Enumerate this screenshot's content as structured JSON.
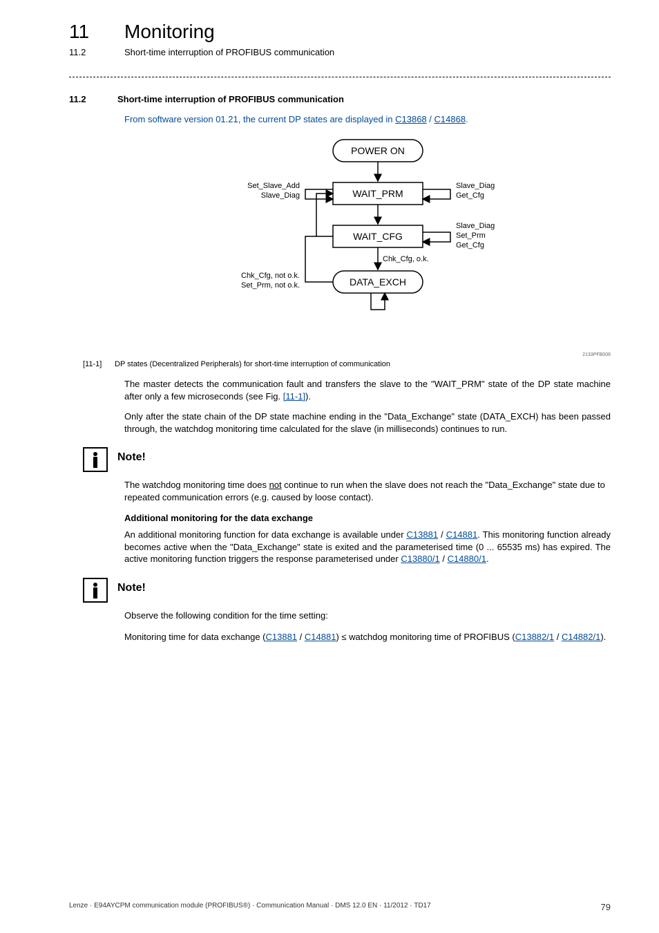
{
  "header": {
    "chapter_number": "11",
    "chapter_title": "Monitoring",
    "sub_number": "11.2",
    "sub_title": "Short-time interruption of PROFIBUS communication"
  },
  "section": {
    "number": "11.2",
    "title": "Short-time interruption of PROFIBUS communication"
  },
  "intro": {
    "prefix": "From software version 01.21, the current DP states are displayed in ",
    "link1": "C13868",
    "sep": " / ",
    "link2": "C14868",
    "suffix": "."
  },
  "diagram": {
    "power_on": "POWER ON",
    "wait_prm": "WAIT_PRM",
    "wait_cfg": "WAIT_CFG",
    "data_exch": "DATA_EXCH",
    "left_top1": "Set_Slave_Add",
    "left_top2": "Slave_Diag",
    "right_top1": "Slave_Diag",
    "right_top2": "Get_Cfg",
    "right_mid1": "Slave_Diag",
    "right_mid2": "Set_Prm",
    "right_mid3": "Get_Cfg",
    "chk_ok": "Chk_Cfg, o.k.",
    "left_bot1": "Chk_Cfg, not o.k.",
    "left_bot2": "Set_Prm, not o.k.",
    "code": "2133PFB006"
  },
  "figure": {
    "label": "[11-1]",
    "caption": "DP states (Decentralized Peripherals) for short-time interruption of communication"
  },
  "para1": {
    "t1": "The master detects the communication fault and transfers the slave to the \"WAIT_PRM\" state of the DP state machine after only a few microseconds (see Fig. ",
    "link": "[11-1]",
    "t2": ")."
  },
  "para2": "Only after the state chain of the DP state machine ending in the \"Data_Exchange\" state (DATA_EXCH) has been passed through, the watchdog monitoring time calculated for the slave (in milliseconds) continues to run.",
  "note1": {
    "title": "Note!",
    "body_a": "The watchdog monitoring time does ",
    "body_u": "not",
    "body_b": " continue to run when the slave does not reach the \"Data_Exchange\" state due to repeated communication errors (e.g. caused by loose contact)."
  },
  "subhead": "Additional monitoring for the data exchange",
  "para3": {
    "t1": "An additional monitoring function for data exchange is available under ",
    "l1": "C13881",
    "sep1": " / ",
    "l2": "C14881",
    "t2": ". This monitoring function already becomes active when the \"Data_Exchange\" state is exited and the parameterised time (0 ... 65535 ms) has expired. The active monitoring function triggers the response parameterised under ",
    "l3": "C13880/1",
    "sep2": " / ",
    "l4": "C14880/1",
    "t3": "."
  },
  "note2": {
    "title": "Note!",
    "line1": "Observe the following condition for the time setting:",
    "line2_a": "Monitoring time for data exchange (",
    "line2_l1": "C13881",
    "line2_s1": " / ",
    "line2_l2": "C14881",
    "line2_b": ") ≤ watchdog monitoring time of PROFIBUS (",
    "line2_l3": "C13882/1",
    "line2_s2": " / ",
    "line2_l4": "C14882/1",
    "line2_c": ")."
  },
  "footer": {
    "left": "Lenze · E94AYCPM communication module (PROFIBUS®) · Communication Manual · DMS 12.0 EN · 11/2012 · TD17",
    "page": "79"
  }
}
